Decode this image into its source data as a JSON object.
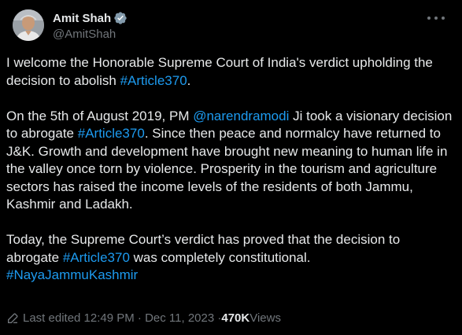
{
  "author": {
    "display_name": "Amit Shah",
    "handle": "@AmitShah",
    "verified_icon": "verified-badge-icon",
    "avatar_icon": "avatar"
  },
  "post": {
    "p1_a": "I welcome the Honorable Supreme Court of India's verdict upholding the decision to abolish ",
    "p1_hashtag": "#Article370",
    "p1_b": ".",
    "p2_a": "On the 5th of August 2019, PM ",
    "p2_mention": "@narendramodi",
    "p2_b": " Ji took a visionary decision to abrogate ",
    "p2_hashtag": "#Article370",
    "p2_c": ". Since then peace and normalcy have returned to J&K. Growth and development have brought new meaning to human life in the valley once torn by violence. Prosperity in the tourism and agriculture sectors has raised the income levels of the residents of both Jammu, Kashmir and Ladakh.",
    "p3_a": "Today, the Supreme Court’s verdict has proved that the decision to abrogate ",
    "p3_hashtag": "#Article370",
    "p3_b": " was completely constitutional.",
    "p4_hashtag": "#NayaJammuKashmir"
  },
  "meta": {
    "edited_label": "Last edited 12:49 PM · Dec 11, 2023 · ",
    "views_count": "470K",
    "views_label": " Views"
  },
  "colors": {
    "background": "#000000",
    "text": "#e7e9ea",
    "muted": "#71767b",
    "link": "#1d9bf0",
    "verified": "#829aab"
  }
}
